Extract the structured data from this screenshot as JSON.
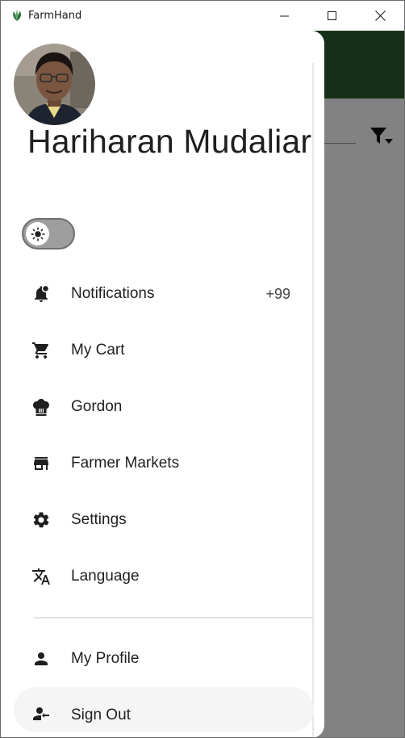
{
  "window": {
    "title": "FarmHand",
    "controls": [
      "minimize-icon",
      "maximize-icon",
      "close-icon"
    ]
  },
  "colors": {
    "app_bar": "#2a5e2c",
    "scrim": "#7f7f7f",
    "drawer_bg": "#ffffff",
    "text": "#1f1f1f"
  },
  "drawer": {
    "user_name": "Hariharan Mudaliar",
    "theme_toggle": {
      "icon": "sun-icon",
      "state": "light"
    },
    "items": [
      {
        "label": "Notifications",
        "icon": "notification-bell-icon",
        "badge": "+99"
      },
      {
        "label": "My Cart",
        "icon": "cart-icon"
      },
      {
        "label": "Gordon",
        "icon": "chef-hat-icon"
      },
      {
        "label": "Farmer Markets",
        "icon": "store-icon"
      },
      {
        "label": "Settings",
        "icon": "gear-icon"
      },
      {
        "label": "Language",
        "icon": "translate-icon"
      }
    ],
    "bottom_items": [
      {
        "label": "My Profile",
        "icon": "person-icon"
      },
      {
        "label": "Sign Out",
        "icon": "sign-out-icon"
      }
    ]
  },
  "background_app": {
    "filter_icon": "filter-icon"
  }
}
